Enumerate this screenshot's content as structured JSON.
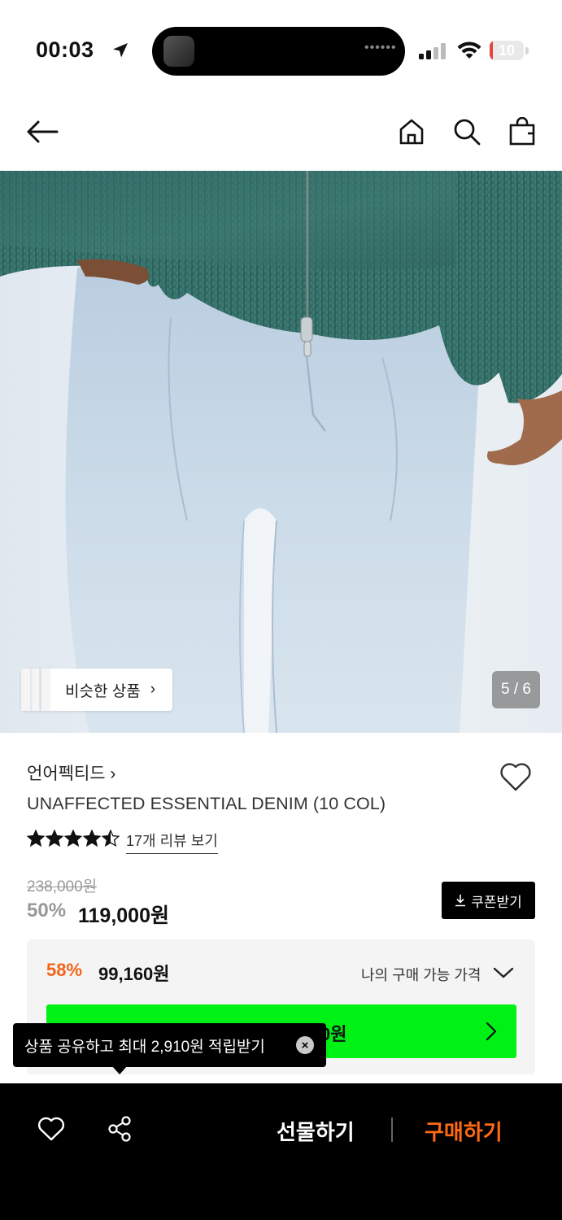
{
  "status_bar": {
    "time": "00:03",
    "battery": "10",
    "battery_level": 0.1,
    "icons": [
      "location-arrow-icon",
      "signal-icon",
      "wifi-icon",
      "battery-icon"
    ],
    "island_dots": "••••••"
  },
  "nav": {
    "icons": [
      "back-arrow-icon",
      "home-icon",
      "search-icon",
      "shopping-bag-icon"
    ]
  },
  "gallery": {
    "similar_label": "비슷한 상품",
    "similar_chevron": "›",
    "pager": "5 / 6"
  },
  "product": {
    "brand": "언어펙티드 ›",
    "title": "UNAFFECTED ESSENTIAL DENIM (10 COL)",
    "rating": 4.5,
    "review_link": "17개 리뷰 보기",
    "original_price": "238,000원",
    "discount": "50%",
    "price": "119,000원",
    "coupon_label": "쿠폰받기"
  },
  "member_price": {
    "discount": "58%",
    "price": "99,160원",
    "label": "나의 구매 가능 가격",
    "bar_text": "0원"
  },
  "tooltip": {
    "text": "상품 공유하고 최대 2,910원 적립받기",
    "close": "×"
  },
  "bottom_bar": {
    "gift_label": "선물하기",
    "buy_label": "구매하기"
  },
  "colors": {
    "accent_orange": "#f26419",
    "buy_orange": "#ff6a13",
    "green_banner": "#00f115",
    "battery_red": "#e5443a"
  }
}
